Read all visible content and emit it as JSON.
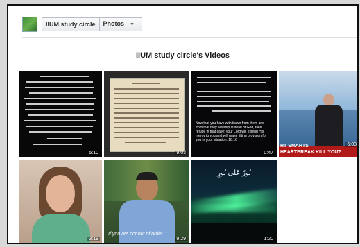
{
  "breadcrumb": {
    "page_name": "IIUM study circle",
    "section": "Photos"
  },
  "page_title": "IIUM study circle's Videos",
  "videos": [
    {
      "duration": "5:10"
    },
    {
      "duration": "9:03"
    },
    {
      "duration": "0:47",
      "caption": "Now that you have withdrawn from them and from that they worship instead of God, take refuge in that cave; your Lord will extend His mercy to you and will make fitting provision for you in your situation: ",
      "caption_ref": "18:16"
    },
    {
      "duration": "6:03",
      "overlay": "RT SMARTS",
      "overlay2": "HEARTBREAK KILL YOU?"
    },
    {
      "duration": "3:19"
    },
    {
      "duration": "9:29",
      "subtitle": "If you are not out of order"
    },
    {
      "duration": "1:20",
      "arabic_title": "نُورٌ عَلَى نُورٍ"
    }
  ]
}
